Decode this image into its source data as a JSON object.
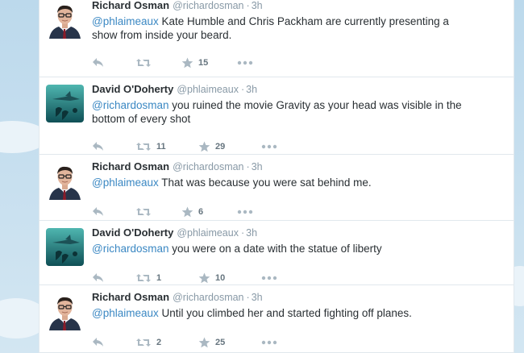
{
  "tweets": [
    {
      "fullname": "Richard Osman",
      "username": "@richardosman",
      "separator": "·",
      "time": "3h",
      "mention": "@phlaimeaux",
      "text": " Kate Humble and Chris Packham are currently presenting a show from inside your beard.",
      "retweets": "",
      "favorites": "15",
      "avatar": "richard"
    },
    {
      "fullname": "David O'Doherty",
      "username": "@phlaimeaux",
      "separator": "·",
      "time": "3h",
      "mention": "@richardosman",
      "text": " you ruined the movie Gravity as your head was visible in the bottom of every shot",
      "retweets": "11",
      "favorites": "29",
      "avatar": "david"
    },
    {
      "fullname": "Richard Osman",
      "username": "@richardosman",
      "separator": "·",
      "time": "3h",
      "mention": "@phlaimeaux",
      "text": " That was because you were sat behind me.",
      "retweets": "",
      "favorites": "6",
      "avatar": "richard"
    },
    {
      "fullname": "David O'Doherty",
      "username": "@phlaimeaux",
      "separator": "·",
      "time": "3h",
      "mention": "@richardosman",
      "text": " you were on a date with the statue of liberty",
      "retweets": "1",
      "favorites": "10",
      "avatar": "david"
    },
    {
      "fullname": "Richard Osman",
      "username": "@richardosman",
      "separator": "·",
      "time": "3h",
      "mention": "@phlaimeaux",
      "text": " Until you climbed her and started fighting off planes.",
      "retweets": "2",
      "favorites": "25",
      "avatar": "richard"
    }
  ],
  "icons": {
    "reply": "reply-icon",
    "retweet": "retweet-icon",
    "favorite": "star-icon",
    "more": "more-icon"
  },
  "colors": {
    "mention": "#3b88c3",
    "muted": "#8899a6",
    "icon": "#aab8c2",
    "text": "#292f33"
  }
}
